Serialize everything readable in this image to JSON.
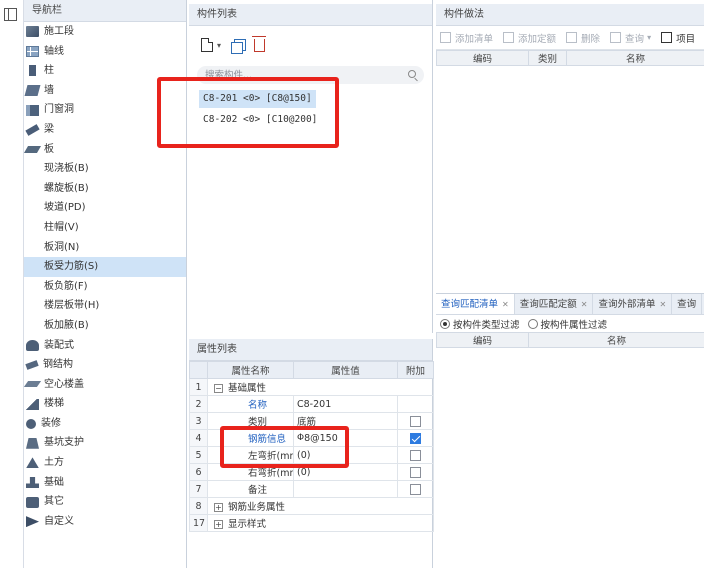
{
  "nav": {
    "title": "导航栏",
    "items": [
      {
        "label": "施工段",
        "icon": "construction-section-icon",
        "cls": "top",
        "ico": "block"
      },
      {
        "label": "轴线",
        "icon": "grid-axis-icon",
        "cls": "top",
        "ico": "grid"
      },
      {
        "label": "柱",
        "icon": "column-icon",
        "cls": "top",
        "ico": "col"
      },
      {
        "label": "墙",
        "icon": "wall-icon",
        "cls": "top",
        "ico": "wall"
      },
      {
        "label": "门窗洞",
        "icon": "door-window-icon",
        "cls": "top",
        "ico": "door"
      },
      {
        "label": "梁",
        "icon": "beam-icon",
        "cls": "top",
        "ico": "beam"
      },
      {
        "label": "板",
        "icon": "slab-icon",
        "cls": "top",
        "ico": "slab"
      },
      {
        "label": "现浇板(B)",
        "cls": "sub"
      },
      {
        "label": "螺旋板(B)",
        "cls": "sub"
      },
      {
        "label": "坡道(PD)",
        "cls": "sub"
      },
      {
        "label": "柱帽(V)",
        "cls": "sub"
      },
      {
        "label": "板洞(N)",
        "cls": "sub"
      },
      {
        "label": "板受力筋(S)",
        "cls": "sub selected"
      },
      {
        "label": "板负筋(F)",
        "cls": "sub"
      },
      {
        "label": "楼层板带(H)",
        "cls": "sub"
      },
      {
        "label": "板加腋(B)",
        "cls": "sub"
      },
      {
        "label": "装配式",
        "icon": "prefab-icon",
        "cls": "top",
        "ico": "prefab"
      },
      {
        "label": "钢结构",
        "icon": "steel-structure-icon",
        "cls": "top",
        "ico": "steel"
      },
      {
        "label": "空心楼盖",
        "icon": "hollow-floor-icon",
        "cls": "top",
        "ico": "hollow"
      },
      {
        "label": "楼梯",
        "icon": "stair-icon",
        "cls": "top",
        "ico": "stair"
      },
      {
        "label": "装修",
        "icon": "decoration-icon",
        "cls": "top",
        "ico": "deco"
      },
      {
        "label": "基坑支护",
        "icon": "pit-support-icon",
        "cls": "top",
        "ico": "pit"
      },
      {
        "label": "土方",
        "icon": "earthwork-icon",
        "cls": "top",
        "ico": "earth"
      },
      {
        "label": "基础",
        "icon": "foundation-icon",
        "cls": "top",
        "ico": "found"
      },
      {
        "label": "其它",
        "icon": "other-icon",
        "cls": "top",
        "ico": "other"
      },
      {
        "label": "自定义",
        "icon": "custom-icon",
        "cls": "top",
        "ico": "custom"
      }
    ]
  },
  "component_list": {
    "title": "构件列表",
    "search_placeholder": "搜索构件...",
    "items": [
      {
        "label": "C8-201 <0> [C8@150]",
        "selected": true
      },
      {
        "label": "C8-202 <0> [C10@200]",
        "selected": false
      }
    ]
  },
  "properties": {
    "title": "属性列表",
    "headers": {
      "name": "属性名称",
      "value": "属性值",
      "extra": "附加"
    },
    "rows": [
      {
        "num": "1",
        "name": "基础属性",
        "value": "",
        "kind": "group",
        "exp": "−",
        "check": null
      },
      {
        "num": "2",
        "name": "名称",
        "value": "C8-201",
        "kind": "blue",
        "check": null
      },
      {
        "num": "3",
        "name": "类别",
        "value": "底筋",
        "kind": "plain",
        "check": false
      },
      {
        "num": "4",
        "name": "钢筋信息",
        "value": "8@150",
        "kind": "blue",
        "rebar": "Φ",
        "check": true
      },
      {
        "num": "5",
        "name": "左弯折(mm)",
        "value": "(0)",
        "kind": "plain",
        "check": false
      },
      {
        "num": "6",
        "name": "右弯折(mm)",
        "value": "(0)",
        "kind": "plain",
        "check": false
      },
      {
        "num": "7",
        "name": "备注",
        "value": "",
        "kind": "plain",
        "check": false
      },
      {
        "num": "8",
        "name": "钢筋业务属性",
        "value": "",
        "kind": "group",
        "exp": "+",
        "check": null
      },
      {
        "num": "17",
        "name": "显示样式",
        "value": "",
        "kind": "group",
        "exp": "+",
        "check": null
      }
    ]
  },
  "method": {
    "title": "构件做法",
    "toolbar": [
      "添加清单",
      "添加定额",
      "删除",
      "查询",
      "项目"
    ],
    "headers": [
      "编码",
      "类别",
      "名称"
    ]
  },
  "query": {
    "tabs": [
      "查询匹配清单",
      "查询匹配定额",
      "查询外部清单",
      "查询"
    ],
    "filters": [
      "按构件类型过滤",
      "按构件属性过滤"
    ],
    "headers": [
      "编码",
      "名称"
    ]
  },
  "colors": {
    "highlight": "#e8231c",
    "selection": "#cfe3f7",
    "link": "#1f5fbf"
  }
}
